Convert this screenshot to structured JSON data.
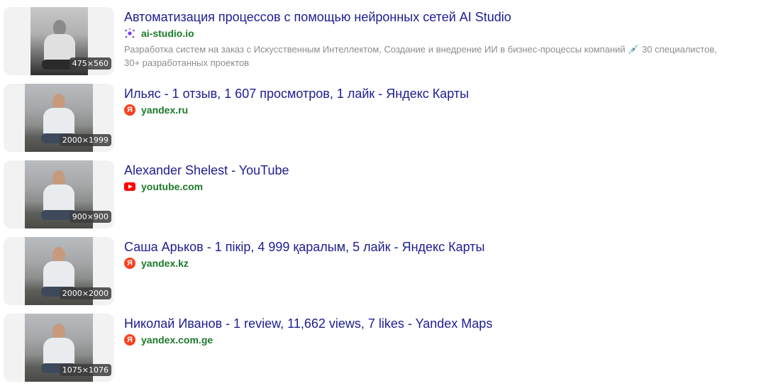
{
  "results": [
    {
      "title": "Автоматизация процессов с помощью нейронных сетей AI Studio",
      "host": "ai-studio.io",
      "icon": "ai-studio-icon",
      "dims": "475×560",
      "description": "Разработка систем на заказ с Искусственным Интеллектом, Создание и внедрение ИИ в бизнес-процессы компаний 💉 30 специалистов, 30+ разработанных проектов"
    },
    {
      "title": "Ильяс - 1 отзыв, 1 607 просмотров, 1 лайк - Яндекс Карты",
      "host": "yandex.ru",
      "icon": "yandex-icon",
      "dims": "2000×1999"
    },
    {
      "title": "Alexander Shelest - YouTube",
      "host": "youtube.com",
      "icon": "youtube-icon",
      "dims": "900×900"
    },
    {
      "title": "Саша Арьков - 1 пікір, 4 999 қаралым, 5 лайк - Яндекс Карты",
      "host": "yandex.kz",
      "icon": "yandex-icon",
      "dims": "2000×2000"
    },
    {
      "title": "Николай Иванов - 1 review, 11,662 views, 7 likes - Yandex Maps",
      "host": "yandex.com.ge",
      "icon": "yandex-icon",
      "dims": "1075×1076"
    }
  ],
  "icons": {
    "yandex_letter": "Я"
  },
  "colors": {
    "title": "#1d1d91",
    "host": "#1b7a2a",
    "description": "#8c8c8c",
    "yandex": "#fc3f1d",
    "youtube": "#ff0000"
  }
}
